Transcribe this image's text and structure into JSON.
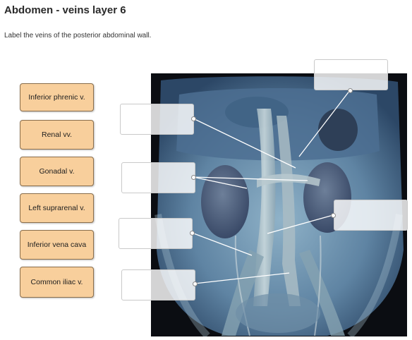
{
  "header": {
    "title": "Abdomen - veins layer 6",
    "instructions": "Label the veins of the posterior abdominal wall."
  },
  "labels": [
    "Inferior phrenic v.",
    "Renal vv.",
    "Gonadal v.",
    "Left suprarenal v.",
    "Inferior vena cava",
    "Common iliac v."
  ],
  "colors": {
    "chip_fill": "#f8cf9c",
    "chip_border": "#8a6e4c",
    "leader_line": "#ffffff"
  }
}
